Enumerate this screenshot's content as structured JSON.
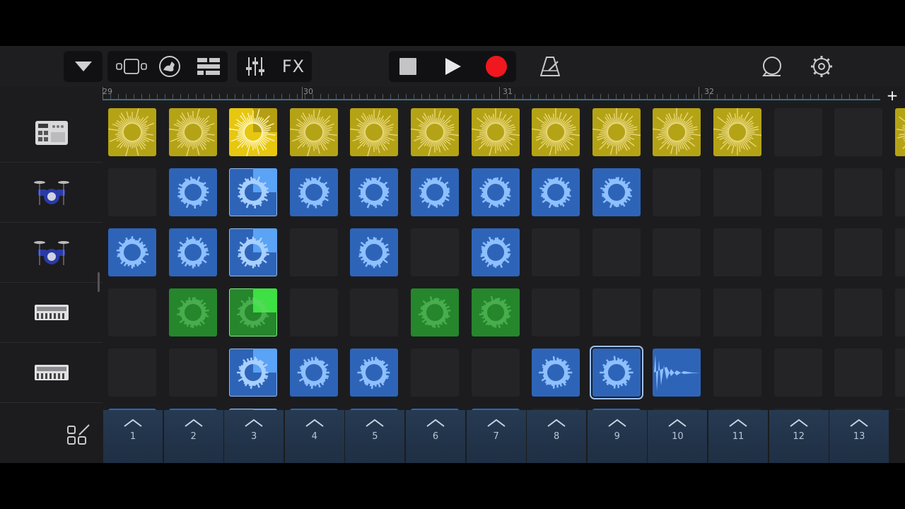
{
  "toolbar": {
    "fx_label": "FX",
    "icons": [
      "chevron-down-icon",
      "view-toggle-icon",
      "sound-browser-icon",
      "tracks-view-icon",
      "mixer-icon",
      "stop-icon",
      "play-icon",
      "record-icon",
      "metronome-icon",
      "loop-icon",
      "settings-icon"
    ]
  },
  "ruler": {
    "bars": [
      "29",
      "30",
      "31",
      "32"
    ]
  },
  "tracks": [
    {
      "name": "beat-sequencer-track",
      "icon": "drum-machine-icon"
    },
    {
      "name": "drummer-track-1",
      "icon": "drum-kit-icon"
    },
    {
      "name": "drummer-track-2",
      "icon": "drum-kit-icon"
    },
    {
      "name": "synth-track-1",
      "icon": "keyboard-synth-icon"
    },
    {
      "name": "synth-track-2",
      "icon": "keyboard-synth-icon"
    }
  ],
  "grid": {
    "rows": [
      [
        "y",
        "y",
        "Y",
        "y",
        "y",
        "y",
        "y",
        "y",
        "y",
        "y",
        "y",
        "e",
        "e",
        "y"
      ],
      [
        "e",
        "b",
        "B",
        "b",
        "b",
        "b",
        "b",
        "b",
        "b",
        "e",
        "e",
        "e",
        "e",
        "e"
      ],
      [
        "b",
        "b",
        "B",
        "e",
        "b",
        "e",
        "b",
        "e",
        "e",
        "e",
        "e",
        "e",
        "e",
        "e"
      ],
      [
        "e",
        "g",
        "G",
        "e",
        "e",
        "g",
        "g",
        "e",
        "e",
        "e",
        "e",
        "e",
        "e",
        "e"
      ],
      [
        "e",
        "e",
        "B",
        "b",
        "b",
        "e",
        "e",
        "b",
        "S",
        "w",
        "e",
        "e",
        "e",
        "e"
      ]
    ],
    "partial_row": [
      "b",
      "b",
      "B",
      "b",
      "b",
      "b",
      "b",
      "e",
      "b",
      "e",
      "e",
      "e",
      "e",
      "e"
    ],
    "colors": {
      "yellow": "#b5a316",
      "yellow_active": "#e7c710",
      "blue": "#2e64b8",
      "green": "#25862c",
      "empty": "#242427"
    }
  },
  "scenes": [
    "1",
    "2",
    "3",
    "4",
    "5",
    "6",
    "7",
    "8",
    "9",
    "10",
    "11",
    "12",
    "13"
  ]
}
